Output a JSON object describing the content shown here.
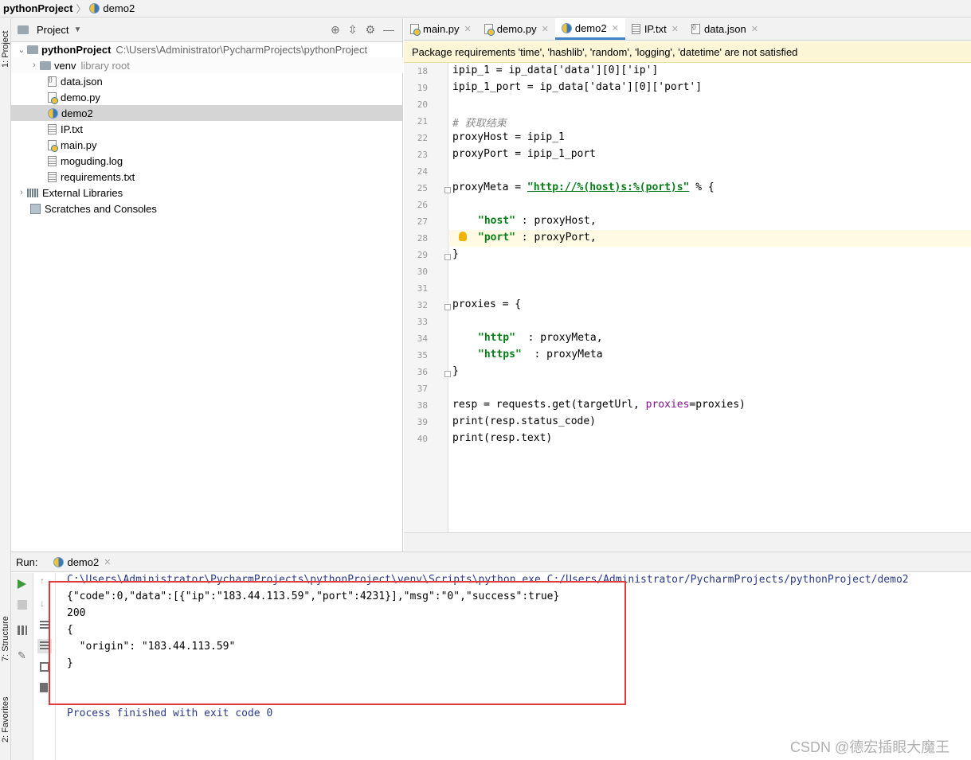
{
  "breadcrumb": {
    "project": "pythonProject",
    "file": "demo2"
  },
  "left_strip": {
    "project_tab": "1: Project",
    "structure_tab": "7: Structure",
    "favorites_tab": "2: Favorites"
  },
  "project_panel": {
    "title": "Project",
    "root_name": "pythonProject",
    "root_path": "C:\\Users\\Administrator\\PycharmProjects\\pythonProject",
    "items": [
      {
        "label": "venv",
        "note": "library root"
      },
      {
        "label": "data.json"
      },
      {
        "label": "demo.py"
      },
      {
        "label": "demo2"
      },
      {
        "label": "IP.txt"
      },
      {
        "label": "main.py"
      },
      {
        "label": "moguding.log"
      },
      {
        "label": "requirements.txt"
      }
    ],
    "external_libraries": "External Libraries",
    "scratches": "Scratches and Consoles"
  },
  "editor": {
    "tabs": [
      "main.py",
      "demo.py",
      "demo2",
      "IP.txt",
      "data.json"
    ],
    "active_tab": "demo2",
    "warning": "Package requirements 'time', 'hashlib', 'random', 'logging', 'datetime' are not satisfied",
    "line_numbers": [
      "18",
      "19",
      "20",
      "21",
      "22",
      "23",
      "24",
      "25",
      "26",
      "27",
      "28",
      "29",
      "30",
      "31",
      "32",
      "33",
      "34",
      "35",
      "36",
      "37",
      "38",
      "39",
      "40"
    ],
    "lines": {
      "l18": "ipip_1 = ip_data['data'][0]['ip']",
      "l19": "ipip_1_port = ip_data['data'][0]['port']",
      "l21": "# 获取结束",
      "l22": "proxyHost = ipip_1",
      "l23": "proxyPort = ipip_1_port",
      "l25_a": "proxyMeta = ",
      "l25_str": "\"http://%(host)s:%(port)s\"",
      "l25_b": " % {",
      "l27_key": "\"host\"",
      "l27_rest": " : proxyHost,",
      "l28_key": "\"port\"",
      "l28_rest": " : proxyPort,",
      "l29": "}",
      "l32": "proxies = {",
      "l34_key": "\"http\"",
      "l34_rest": "  : proxyMeta,",
      "l35_key": "\"https\"",
      "l35_rest": "  : proxyMeta",
      "l36": "}",
      "l38_a": "resp = requests.get(targetUrl, ",
      "l38_kw": "proxies",
      "l38_b": "=proxies)",
      "l39": "print(resp.status_code)",
      "l40": "print(resp.text)"
    }
  },
  "run_panel": {
    "label": "Run:",
    "tab": "demo2",
    "console": {
      "cmd": "C:\\Users\\Administrator\\PycharmProjects\\pythonProject\\venv\\Scripts\\python.exe C:/Users/Administrator/PycharmProjects/pythonProject/demo2",
      "out1": "{\"code\":0,\"data\":[{\"ip\":\"183.44.113.59\",\"port\":4231}],\"msg\":\"0\",\"success\":true}",
      "out2": "200",
      "out3": "{",
      "out4": "  \"origin\": \"183.44.113.59\"",
      "out5": "}",
      "finish": "Process finished with exit code 0"
    }
  },
  "watermark": "CSDN @德宏插眼大魔王",
  "colors": {
    "accent": "#4083c9",
    "highlight_box": "#e03a3a",
    "warning_bg": "#fcf6d6",
    "string": "#067d17",
    "keyword_arg": "#871094"
  }
}
